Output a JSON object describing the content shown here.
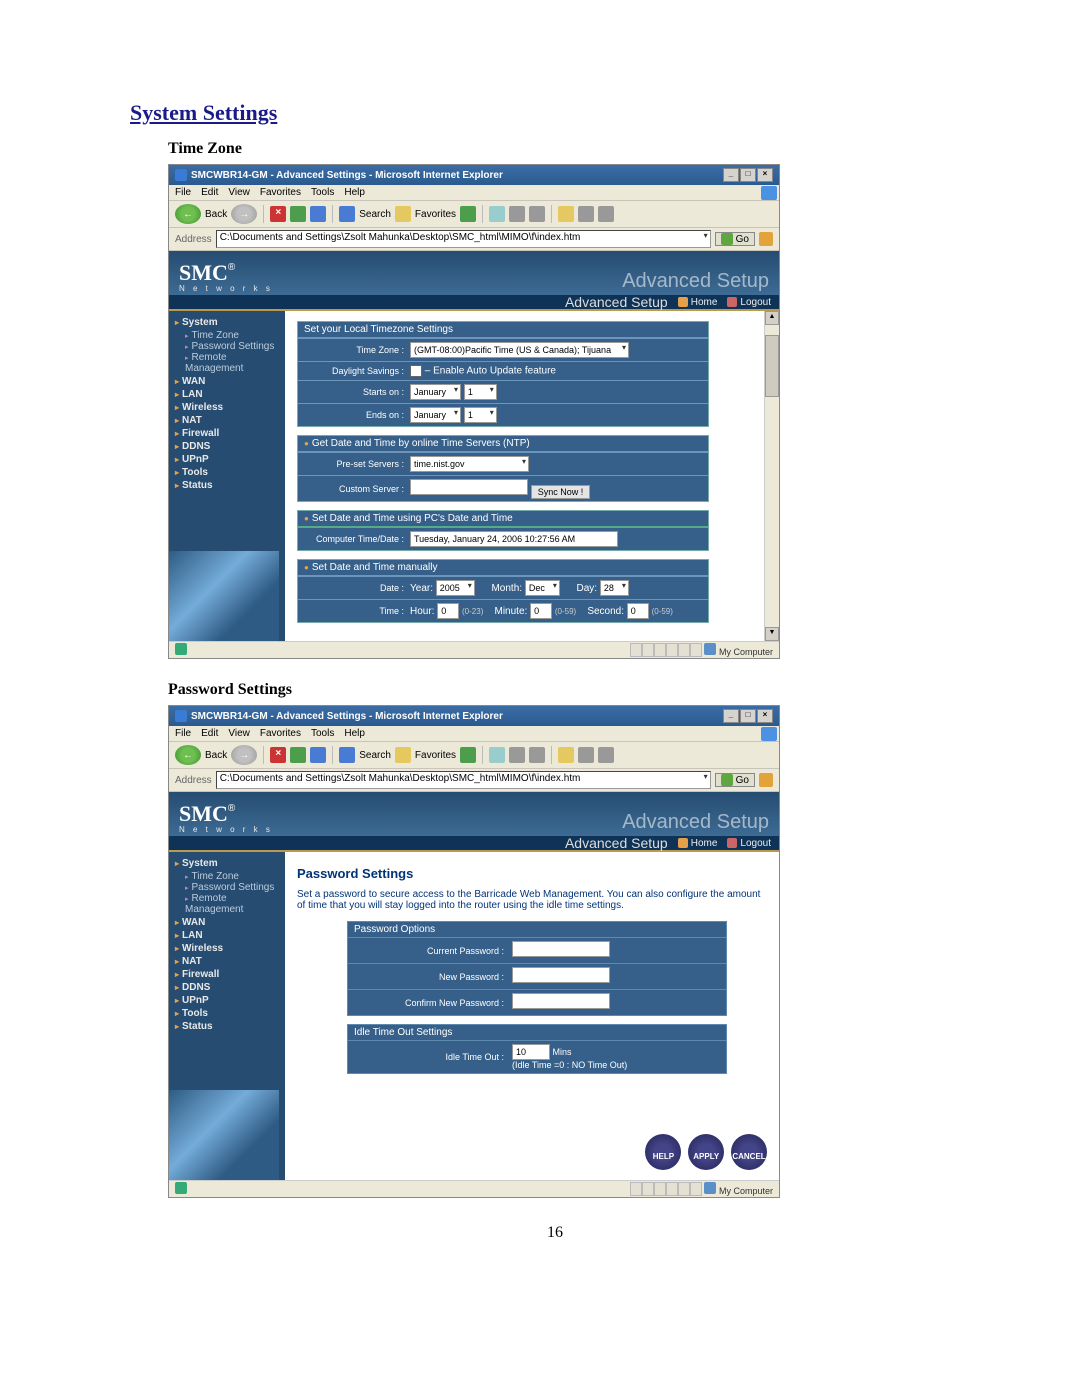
{
  "page": {
    "heading": "System Settings",
    "number": "16"
  },
  "ie": {
    "menus": [
      "File",
      "Edit",
      "View",
      "Favorites",
      "Tools",
      "Help"
    ],
    "toolbar": {
      "back": "Back",
      "search": "Search",
      "favorites": "Favorites"
    },
    "address_label": "Address",
    "go_label": "Go"
  },
  "smc": {
    "logo_text": "SMC",
    "logo_reg": "®",
    "logo_sub": "N e t w o r k s",
    "adv_setup_ghost": "Advanced Setup",
    "adv_setup_label": "Advanced Setup",
    "home_link": "Home",
    "logout_link": "Logout"
  },
  "statusbar": {
    "text": "My Computer"
  },
  "screenshot_timezone": {
    "subheading": "Time Zone",
    "window_title": "SMCWBR14-GM - Advanced Settings - Microsoft Internet Explorer",
    "address_value": "C:\\Documents and Settings\\Zsolt Mahunka\\Desktop\\SMC_html\\MIMO\\f\\index.htm",
    "sidebar": {
      "categories": [
        "System",
        "WAN",
        "LAN",
        "Wireless",
        "NAT",
        "Firewall",
        "DDNS",
        "UPnP",
        "Tools",
        "Status"
      ],
      "system_children": [
        "Time Zone",
        "Password Settings",
        "Remote Management"
      ]
    },
    "panel": {
      "box_tz_header": "Set your Local Timezone Settings",
      "tz_label": "Time Zone :",
      "tz_value": "(GMT-08:00)Pacific Time (US & Canada); Tijuana",
      "dst_label": "Daylight Savings :",
      "dst_text": " – Enable Auto Update feature",
      "starts_label": "Starts on :",
      "starts_month": "January",
      "starts_day": "1",
      "ends_label": "Ends on :",
      "ends_month": "January",
      "ends_day": "1",
      "box_ntp_header": "Get Date and Time by online Time Servers (NTP)",
      "preset_label": "Pre-set Servers :",
      "preset_value": "time.nist.gov",
      "custom_label": "Custom Server :",
      "sync_btn": "Sync Now !",
      "box_pc_header": "Set Date and Time using PC's Date and Time",
      "pc_label": "Computer Time/Date :",
      "pc_value": "Tuesday, January 24, 2006 10:27:56 AM",
      "box_manual_header": "Set Date and Time manually",
      "date_label": "Date :",
      "year_label": "Year:",
      "year_value": "2005",
      "month_label": "Month:",
      "month_value": "Dec",
      "day_label": "Day:",
      "day_value": "28",
      "time_label": "Time :",
      "hour_label": "Hour:",
      "hour_value": "0",
      "hour_range": "(0-23)",
      "minute_label": "Minute:",
      "minute_value": "0",
      "minute_range": "(0-59)",
      "second_label": "Second:",
      "second_value": "0",
      "second_range": "(0-59)"
    }
  },
  "screenshot_password": {
    "subheading": "Password Settings",
    "window_title": "SMCWBR14-GM - Advanced Settings - Microsoft Internet Explorer",
    "address_value": "C:\\Documents and Settings\\Zsolt Mahunka\\Desktop\\SMC_html\\MIMO\\f\\index.htm",
    "sidebar": {
      "categories": [
        "System",
        "WAN",
        "LAN",
        "Wireless",
        "NAT",
        "Firewall",
        "DDNS",
        "UPnP",
        "Tools",
        "Status"
      ],
      "system_children": [
        "Time Zone",
        "Password Settings",
        "Remote Management"
      ]
    },
    "panel": {
      "title": "Password Settings",
      "description": "Set a password to secure access to the Barricade Web Management. You can also configure the amount of time that you will stay logged into the router using the idle time settings.",
      "sec_pw_header": "Password Options",
      "cur_pw_label": "Current Password :",
      "new_pw_label": "New Password :",
      "cfm_pw_label": "Confirm New Password :",
      "sec_idle_header": "Idle Time Out Settings",
      "idle_label": "Idle Time Out :",
      "idle_value": "10",
      "idle_unit": "Mins",
      "idle_note": "(Idle Time =0 : NO Time Out)",
      "btn_help": "HELP",
      "btn_apply": "APPLY",
      "btn_cancel": "CANCEL"
    }
  }
}
